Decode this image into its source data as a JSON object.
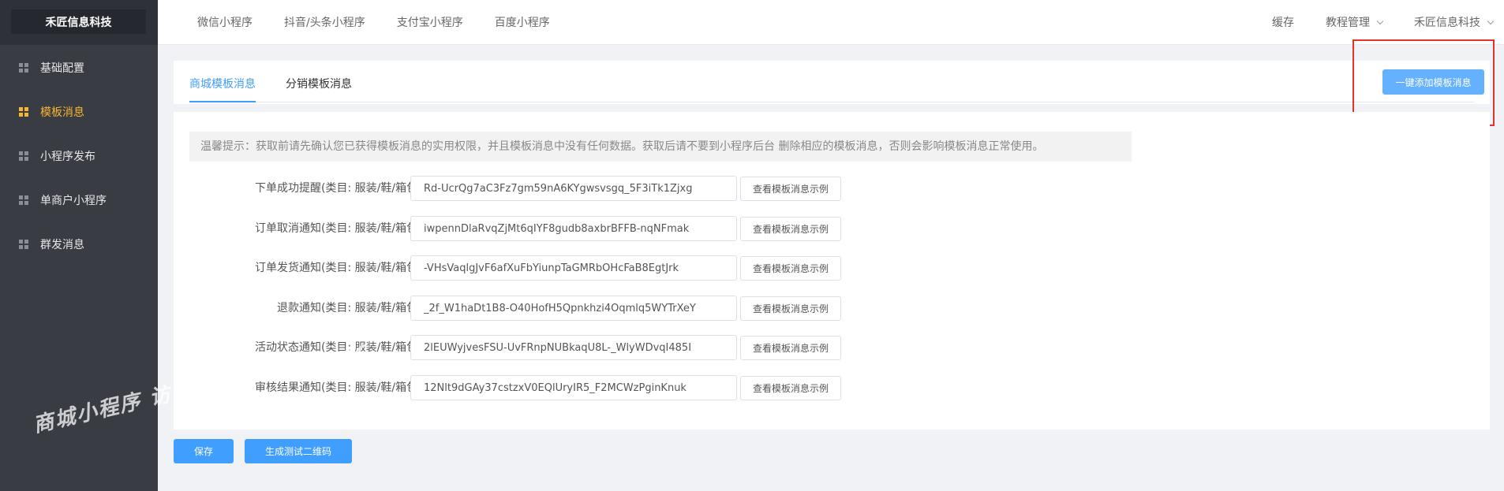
{
  "sidebar": {
    "brand": "禾匠信息科技",
    "items": [
      {
        "label": "基础配置",
        "active": false
      },
      {
        "label": "模板消息",
        "active": true
      },
      {
        "label": "小程序发布",
        "active": false
      },
      {
        "label": "单商户小程序",
        "active": false
      },
      {
        "label": "群发消息",
        "active": false
      }
    ]
  },
  "watermark": "商城小程序 访问www.weike.cc",
  "topbar": {
    "nav": [
      "微信小程序",
      "抖音/头条小程序",
      "支付宝小程序",
      "百度小程序"
    ],
    "cache": "缓存",
    "tutorial": "教程管理",
    "account": "禾匠信息科技"
  },
  "tabs": {
    "items": [
      "商城模板消息",
      "分销模板消息"
    ],
    "active_index": 0
  },
  "add_button": "一键添加模板消息",
  "tip": "温馨提示：获取前请先确认您已获得模板消息的实用权限，并且模板消息中没有任何数据。获取后请不要到小程序后台 删除相应的模板消息，否则会影响模板消息正常使用。",
  "template_rows": [
    {
      "label": "下单成功提醒(类目: 服装/鞋/箱包 )",
      "value": "Rd-UcrQg7aC3Fz7gm59nA6KYgwsvsgq_5F3iTk1Zjxg"
    },
    {
      "label": "订单取消通知(类目: 服装/鞋/箱包 )",
      "value": "iwpennDlaRvqZjMt6qIYF8gudb8axbrBFFB-nqNFmak"
    },
    {
      "label": "订单发货通知(类目: 服装/鞋/箱包 )",
      "value": "-VHsVaqlgJvF6afXuFbYiunpTaGMRbOHcFaB8EgtJrk"
    },
    {
      "label": "退款通知(类目: 服装/鞋/箱包 )",
      "value": "_2f_W1haDt1B8-O40HofH5Qpnkhzi4Oqmlq5WYTrXeY"
    },
    {
      "label": "活动状态通知(类目: 服装/鞋/箱包 )",
      "value": "2lEUWyjvesFSU-UvFRnpNUBkaqU8L-_WlyWDvqI485I"
    },
    {
      "label": "审核结果通知(类目: 服装/鞋/箱包 )",
      "value": "12Nlt9dGAy37cstzxV0EQlUryIR5_F2MCWzPginKnuk"
    }
  ],
  "example_button": "查看模板消息示例",
  "footer": {
    "save": "保存",
    "qrcode": "生成测试二维码"
  },
  "colors": {
    "sidebar_bg": "#393c43",
    "active_menu": "#f7b533",
    "primary": "#409eff",
    "highlight_box": "#e5322d"
  }
}
